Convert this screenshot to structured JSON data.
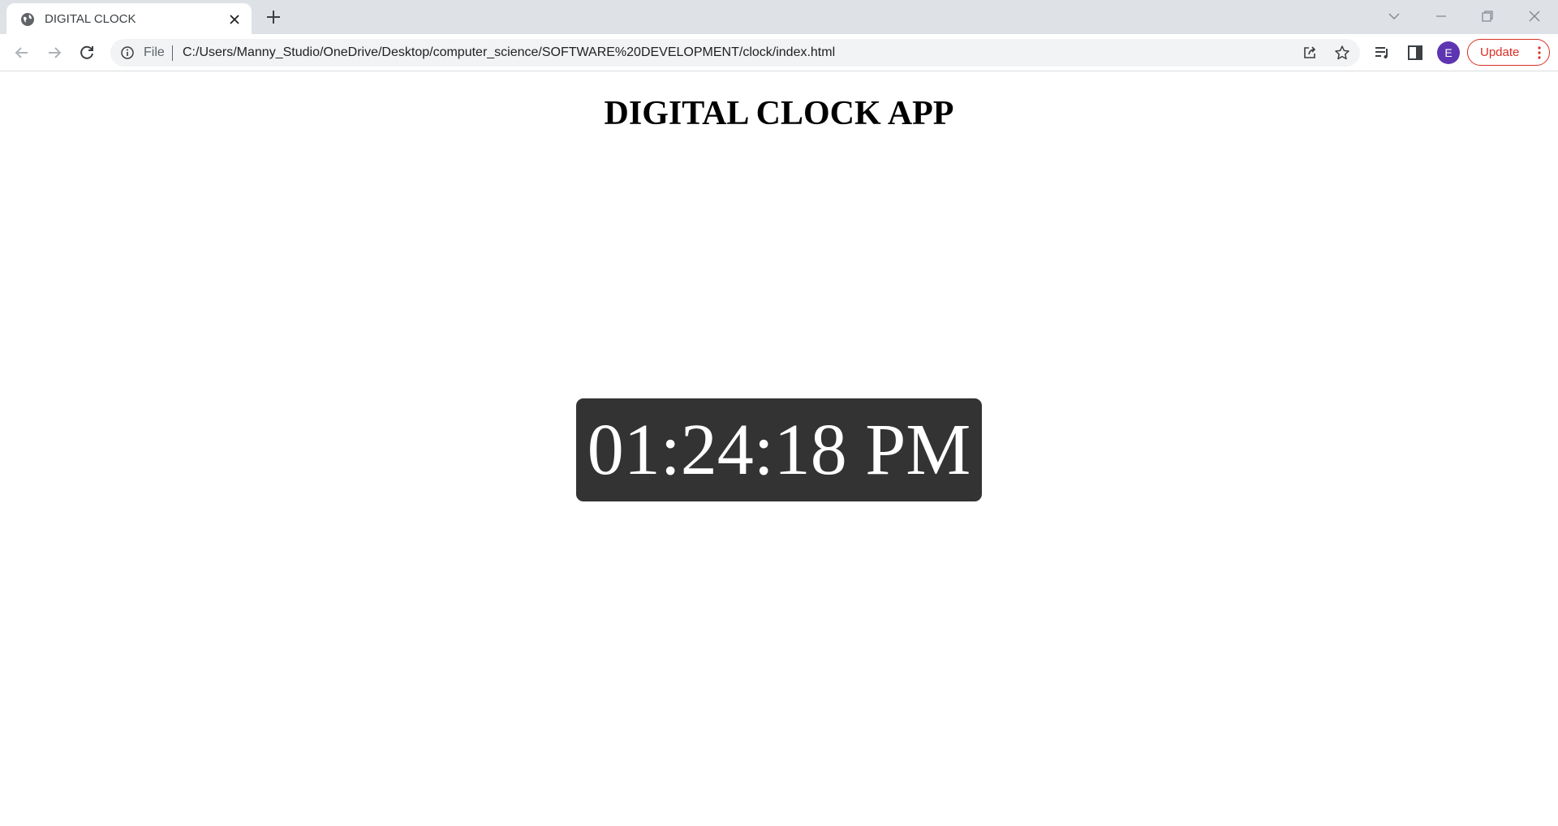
{
  "browser": {
    "tab": {
      "title": "DIGITAL CLOCK",
      "favicon": "globe-icon",
      "close_icon": "close-icon"
    },
    "new_tab_icon": "plus-icon",
    "window_controls": [
      "tab-search-icon",
      "minimize-icon",
      "restore-icon",
      "close-icon"
    ],
    "toolbar": {
      "back_icon": "arrow-left-icon",
      "forward_icon": "arrow-right-icon",
      "reload_icon": "reload-icon",
      "site_info_icon": "info-icon",
      "scheme_label": "File",
      "url": "C:/Users/Manny_Studio/OneDrive/Desktop/computer_science/SOFTWARE%20DEVELOPMENT/clock/index.html",
      "share_icon": "share-icon",
      "bookmark_icon": "star-icon",
      "media_icon": "media-queue-icon",
      "side_panel_icon": "side-panel-icon",
      "profile_initial": "E",
      "update_label": "Update",
      "menu_icon": "kebab-menu-icon"
    }
  },
  "page": {
    "title": "DIGITAL CLOCK APP",
    "clock": {
      "time": "01:24:18 PM"
    }
  },
  "colors": {
    "tabstrip_bg": "#dee1e6",
    "omnibox_bg": "#f1f3f4",
    "clock_bg": "#333333",
    "clock_text": "#ffffff",
    "update_accent": "#d93025",
    "avatar_bg": "#5e35b1"
  }
}
